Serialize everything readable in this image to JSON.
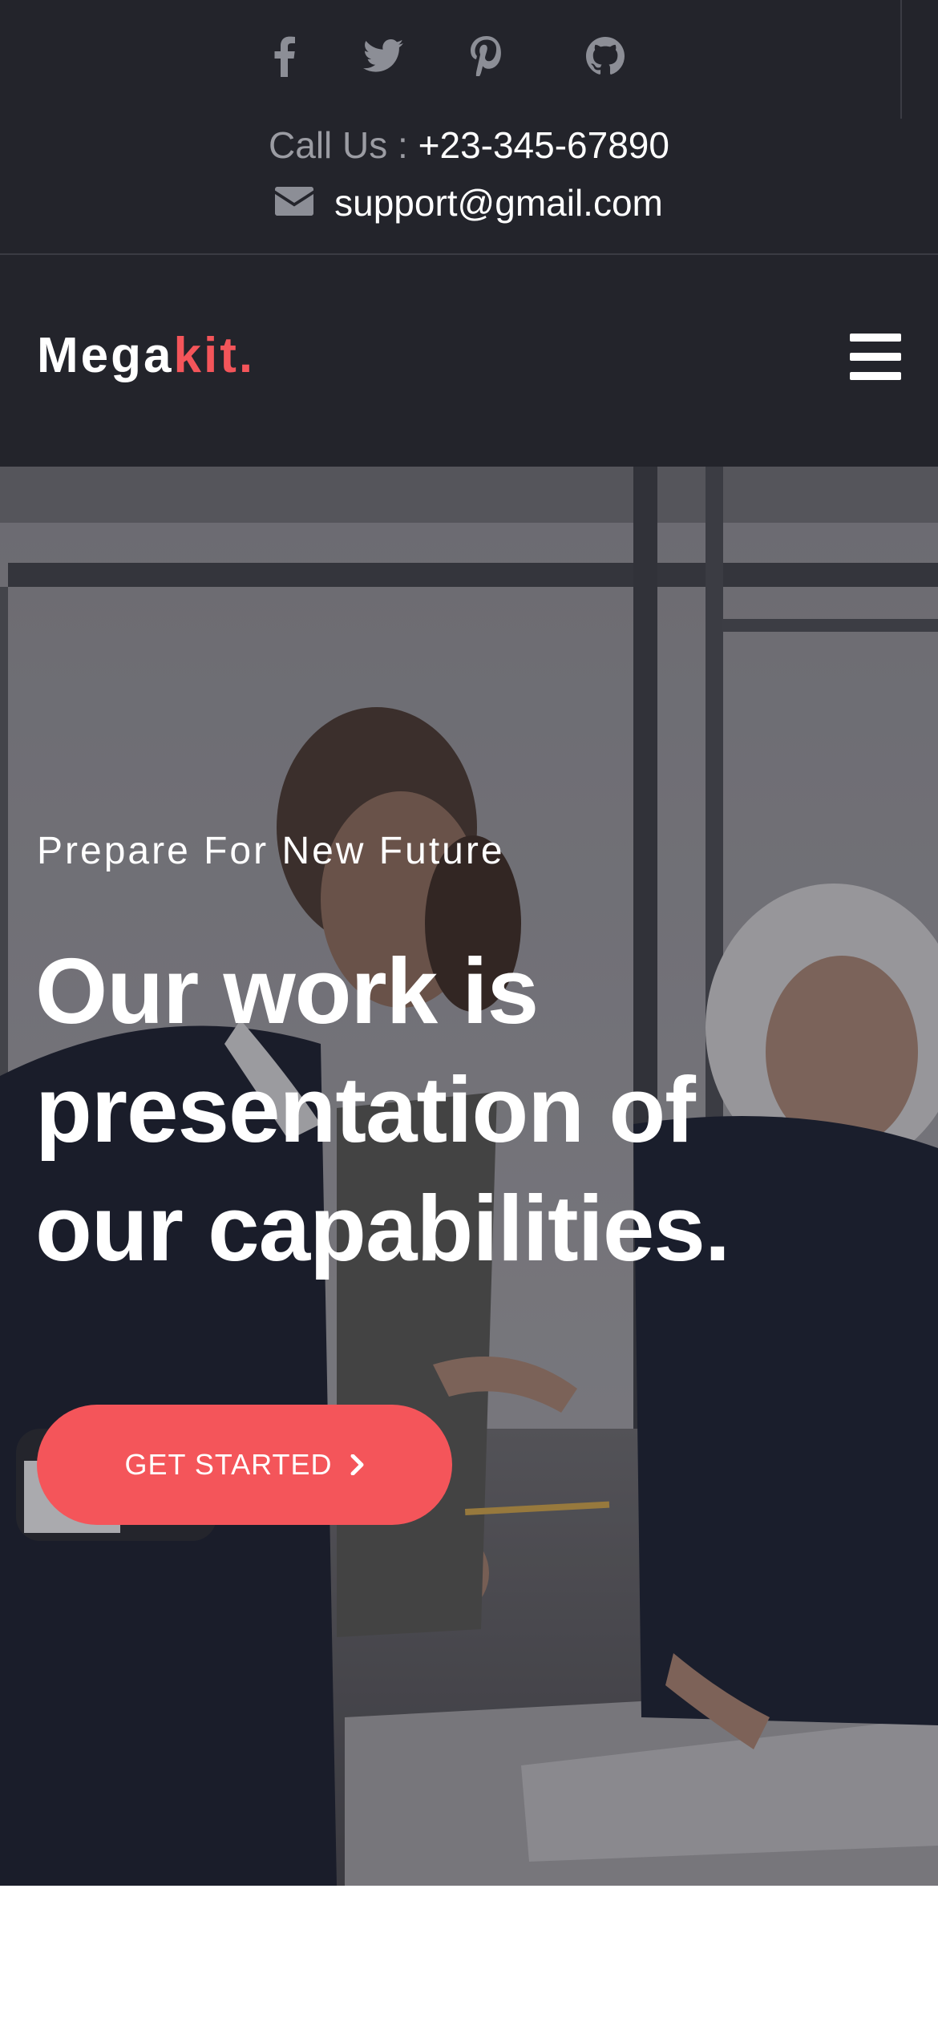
{
  "topbar": {
    "social": [
      {
        "icon": "facebook-icon"
      },
      {
        "icon": "twitter-icon"
      },
      {
        "icon": "pinterest-icon"
      },
      {
        "icon": "github-icon"
      }
    ],
    "call_label": "Call Us : ",
    "phone": "+23-345-67890",
    "email_icon": "envelope-icon",
    "email": "support@gmail.com"
  },
  "nav": {
    "brand_main": "Mega",
    "brand_accent": "kit.",
    "menu_icon": "hamburger-icon"
  },
  "hero": {
    "subtitle": "Prepare For New Future",
    "title_line1": "Our work is",
    "title_line2": "presentation of",
    "title_line3": "our capabilities.",
    "cta_label": "GET STARTED",
    "cta_icon": "chevron-right-icon"
  },
  "colors": {
    "topbar_bg": "#23242b",
    "accent": "#f4555a",
    "muted_text": "#9b9ca3"
  }
}
